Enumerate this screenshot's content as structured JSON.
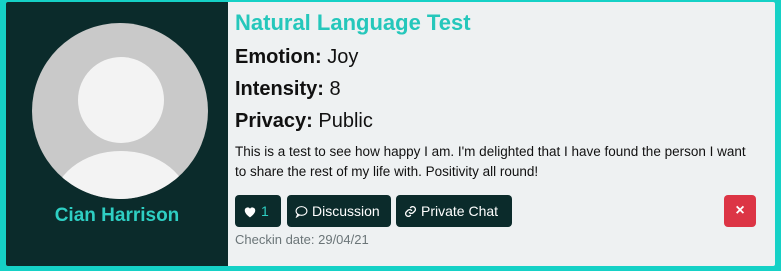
{
  "user": {
    "name": "Cian Harrison"
  },
  "checkin": {
    "title": "Natural Language Test",
    "emotion_label": "Emotion:",
    "emotion": "Joy",
    "intensity_label": "Intensity:",
    "intensity": "8",
    "privacy_label": "Privacy:",
    "privacy": "Public",
    "description": "This is a test to see how happy I am. I'm delighted that I have found the person I want to share the rest of my life with. Positivity all round!",
    "date_text": "Checkin date: 29/04/21"
  },
  "actions": {
    "like_count": "1",
    "discussion_label": "Discussion",
    "private_chat_label": "Private Chat",
    "delete_symbol": "×"
  },
  "colors": {
    "accent": "#25c7bb",
    "dark": "#0b2b2b",
    "danger": "#dc3545"
  },
  "icons": [
    "avatar-placeholder",
    "heart-icon",
    "speech-bubble-icon",
    "link-icon",
    "close-icon"
  ]
}
